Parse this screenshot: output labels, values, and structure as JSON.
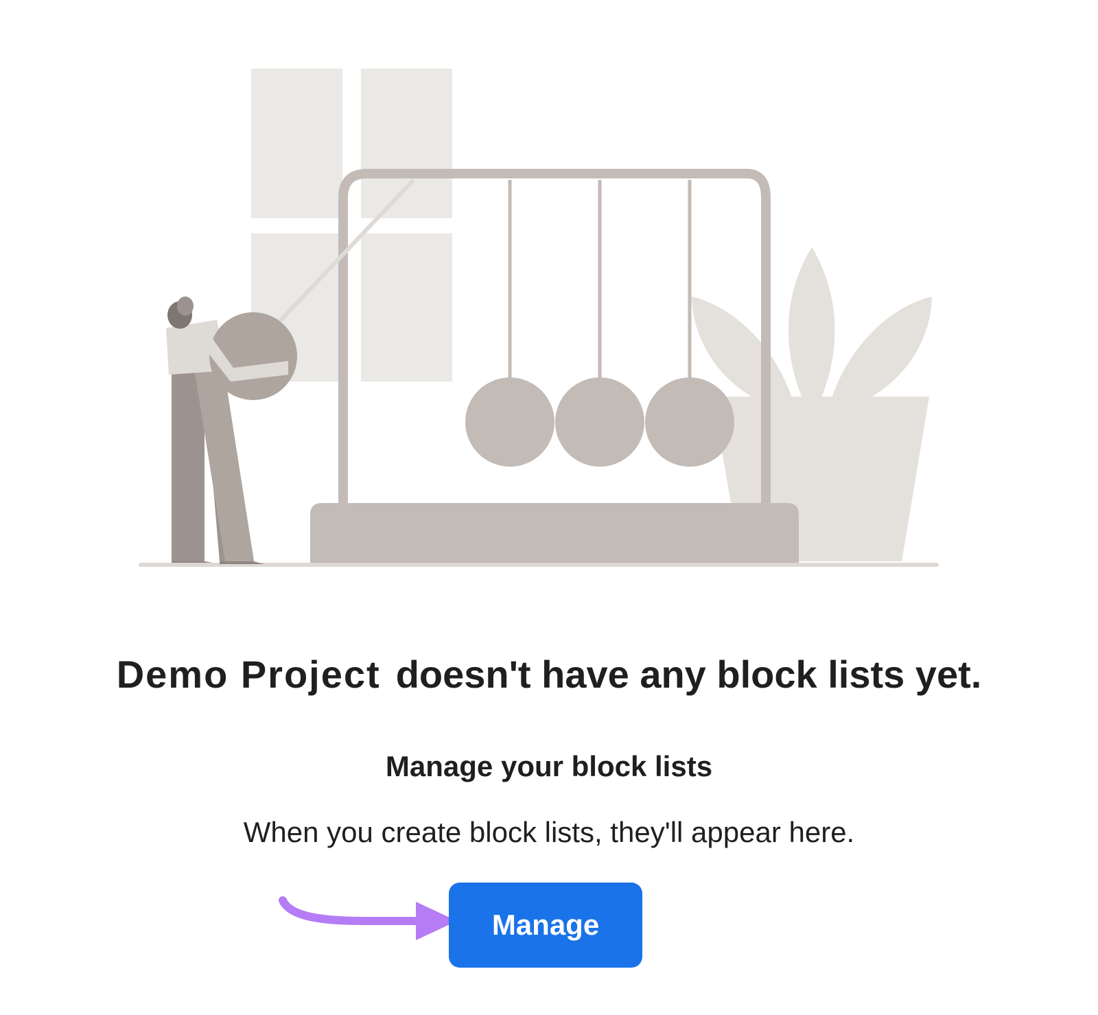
{
  "empty_state": {
    "project_name": "Demo Project",
    "title_suffix": "doesn't have any block lists yet.",
    "heading": "Manage your block lists",
    "description": "When you create block lists, they'll appear here.",
    "manage_label": "Manage"
  },
  "colors": {
    "button": "#1a73e8",
    "button_text": "#ffffff",
    "arrow": "#b57cf5",
    "illustration_light": "#eae9e6",
    "illustration_mid": "#c3bbb6",
    "illustration_dark": "#9c9390",
    "text": "#1f1f1f"
  },
  "illustration": {
    "icon": "newtons-cradle-illustration"
  }
}
